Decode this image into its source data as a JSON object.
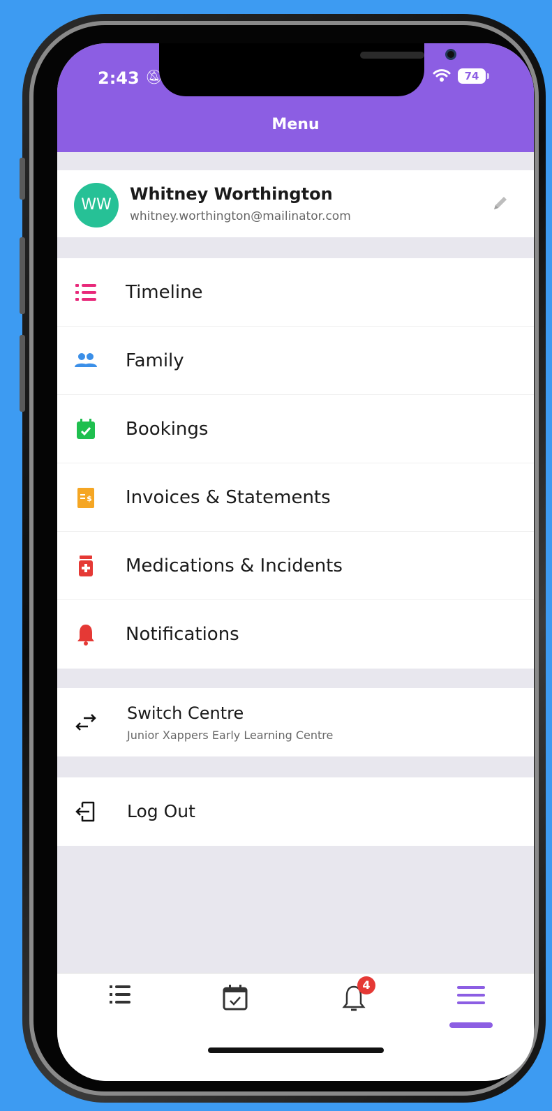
{
  "status_bar": {
    "time": "2:43",
    "battery": "74"
  },
  "header": {
    "title": "Menu"
  },
  "profile": {
    "initials": "WW",
    "name": "Whitney Worthington",
    "email": "whitney.worthington@mailinator.com"
  },
  "menu": {
    "items": [
      {
        "label": "Timeline",
        "icon": "timeline-icon",
        "color": "#e8297a"
      },
      {
        "label": "Family",
        "icon": "family-icon",
        "color": "#3b8fe8"
      },
      {
        "label": "Bookings",
        "icon": "bookings-icon",
        "color": "#1fbf4f"
      },
      {
        "label": "Invoices & Statements",
        "icon": "invoice-icon",
        "color": "#f5a623"
      },
      {
        "label": "Medications & Incidents",
        "icon": "medication-icon",
        "color": "#e53935"
      },
      {
        "label": "Notifications",
        "icon": "notification-bell-icon",
        "color": "#e53935"
      }
    ]
  },
  "switch_centre": {
    "label": "Switch Centre",
    "centre_name": "Junior Xappers Early Learning Centre"
  },
  "logout": {
    "label": "Log Out"
  },
  "tab_bar": {
    "tabs": [
      "timeline-icon",
      "bookings-icon",
      "notification-bell-icon",
      "menu-icon"
    ],
    "notification_count": "4",
    "active_tab": "menu"
  },
  "colors": {
    "accent": "#8c5ee3",
    "avatar": "#26c196",
    "badge": "#e53935"
  }
}
